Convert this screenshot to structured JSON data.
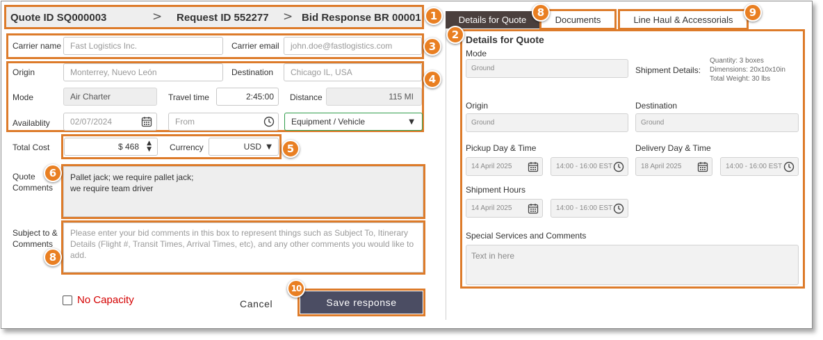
{
  "header": {
    "quote_id": "Quote ID SQ000003",
    "request_id": "Request ID 552277",
    "bid_response": "Bid Response BR 00001",
    "separator": ">"
  },
  "carrier": {
    "name_label": "Carrier name",
    "name_value": "Fast Logistics Inc.",
    "email_label": "Carrier email",
    "email_value": "john.doe@fastlogistics.com"
  },
  "route": {
    "origin_label": "Origin",
    "origin_value": "Monterrey, Nuevo León",
    "destination_label": "Destination",
    "destination_value": "Chicago IL, USA",
    "mode_label": "Mode",
    "mode_value": "Air Charter",
    "travel_time_label": "Travel time",
    "travel_time_value": "2:45:00",
    "distance_label": "Distance",
    "distance_value": "115 MI",
    "availability_label": "Availablity",
    "availability_date": "02/07/2024",
    "from_placeholder": "From",
    "equipment_value": "Equipment / Vehicle"
  },
  "cost": {
    "total_label": "Total Cost",
    "total_value": "$ 468",
    "currency_label": "Currency",
    "currency_value": "USD"
  },
  "quote_comments": {
    "label_line1": "Quote",
    "label_line2": "Comments",
    "line1": "Pallet jack; we require pallet jack;",
    "line2": "we require team driver"
  },
  "subject_comments": {
    "label_line1": "Subject to &",
    "label_line2": "Comments",
    "placeholder": "Please enter your bid comments in this box to represent things such as Subject To, Itinerary Details (Flight #, Transit Times, Arrival Times, etc), and any other comments you would like to add."
  },
  "footer": {
    "no_capacity_label": "No Capacity",
    "cancel_label": "Cancel",
    "save_label": "Save response"
  },
  "tabs": [
    {
      "label": "Details for Quote",
      "active": true
    },
    {
      "label": "Documents",
      "active": false
    },
    {
      "label": "Line Haul & Accessorials",
      "active": false
    }
  ],
  "details": {
    "title": "Details for Quote",
    "mode_label": "Mode",
    "mode_value": "Ground",
    "shipment_label": "Shipment Details:",
    "shipment_lines": [
      "Quantity: 3 boxes",
      "Dimensions: 20x10x10in",
      "Total Weight: 30 lbs"
    ],
    "origin_label": "Origin",
    "origin_value": "Ground",
    "destination_label": "Destination",
    "destination_value": "Ground",
    "pickup_label": "Pickup Day & Time",
    "pickup_date": "14 April 2025",
    "pickup_time": "14:00 - 16:00 EST",
    "delivery_label": "Delivery Day & Time",
    "delivery_date": "18 April 2025",
    "delivery_time": "14:00 - 16:00 EST",
    "hours_label": "Shipment Hours",
    "hours_date": "14 April 2025",
    "hours_time": "14:00 - 16:00 EST",
    "special_label": "Special Services and Comments",
    "special_placeholder": "Text in here"
  },
  "badges": [
    "1",
    "2",
    "3",
    "4",
    "5",
    "6",
    "8",
    "8",
    "9",
    "10"
  ],
  "colors": {
    "highlight": "#dd7b2a",
    "badge": "#e97f22",
    "active_tab": "#4a3f3d",
    "save_button": "#4b4d63",
    "no_capacity": "#d40000",
    "equipment_border": "#2e9c4a"
  },
  "icons": [
    "chevron-right-icon",
    "calendar-icon",
    "clock-icon",
    "stepper-icon",
    "dropdown-arrow-icon",
    "checkbox-icon"
  ]
}
